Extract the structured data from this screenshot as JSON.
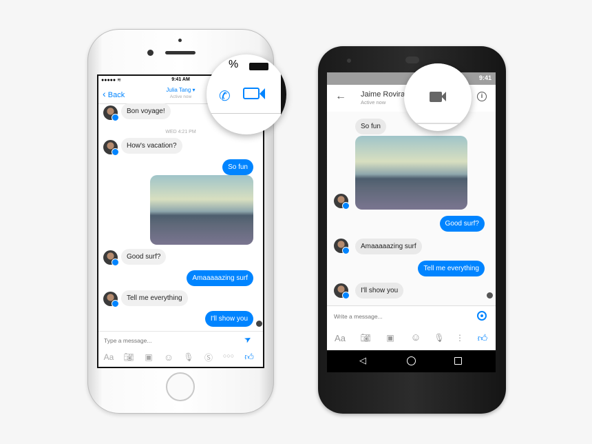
{
  "ios": {
    "status": {
      "time": "9:41 AM",
      "battery_partial": "%"
    },
    "nav": {
      "back": "Back",
      "contact": "Julia Tang",
      "status": "Active now"
    },
    "timestamp": "WED 4:21 PM",
    "messages": [
      {
        "from": "them",
        "text": "Bon voyage!"
      },
      {
        "from": "them",
        "text": "How's vacation?"
      },
      {
        "from": "me",
        "text": "So fun"
      },
      {
        "from": "me",
        "type": "photo"
      },
      {
        "from": "them",
        "text": "Good surf?"
      },
      {
        "from": "me",
        "text": "Amaaaaazing surf"
      },
      {
        "from": "them",
        "text": "Tell me everything"
      },
      {
        "from": "me",
        "text": "I'll show you"
      }
    ],
    "input": {
      "placeholder": "Type a message..."
    },
    "toolbar": [
      "Aa",
      "camera-icon",
      "photos-icon",
      "emoji-icon",
      "mic-icon",
      "payment-icon",
      "more-icon",
      "like-icon"
    ]
  },
  "android": {
    "status": {
      "time": "9:41"
    },
    "header": {
      "contact": "Jaime Rovira",
      "status": "Active now"
    },
    "messages": [
      {
        "from": "them",
        "text": "So fun"
      },
      {
        "from": "them",
        "type": "photo"
      },
      {
        "from": "me",
        "text": "Good surf?"
      },
      {
        "from": "them",
        "text": "Amaaaaazing surf"
      },
      {
        "from": "me",
        "text": "Tell me everything"
      },
      {
        "from": "them",
        "text": "I'll show you"
      }
    ],
    "input": {
      "placeholder": "Write a message..."
    },
    "toolbar": [
      "Aa",
      "camera-icon",
      "image-icon",
      "emoji-icon",
      "mic-icon",
      "more-icon",
      "like-icon"
    ]
  },
  "colors": {
    "accent": "#0084ff",
    "bubble_in": "#f0f0f0"
  }
}
